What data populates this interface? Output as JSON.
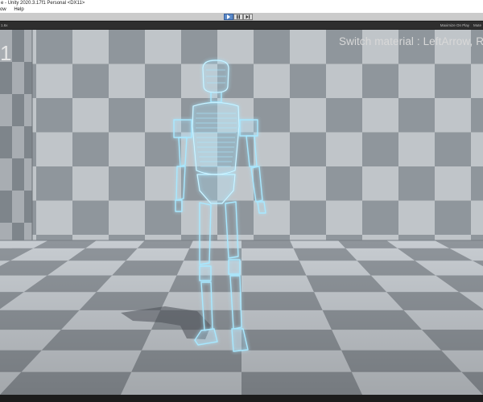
{
  "window": {
    "title": "e - Unity 2020.3.17f1 Personal <DX11>"
  },
  "menu": {
    "items": [
      "ow",
      "Help"
    ]
  },
  "toolbar": {
    "play_icon": "play-icon",
    "pause_icon": "pause-icon",
    "step_icon": "step-icon",
    "play_active": true
  },
  "game_view": {
    "scale_label": "1.6x",
    "maximize_label": "Maximize On Play",
    "mute_label": "Mute"
  },
  "viewport": {
    "counter": "1",
    "hint": "Switch material : LeftArrow, Righ",
    "glow_color": "#9fe6ff",
    "floor_light": "#c7ccd1",
    "floor_dark": "#8f959b",
    "wall_light": "#bfc4c8",
    "wall_dark": "#8c9399"
  }
}
